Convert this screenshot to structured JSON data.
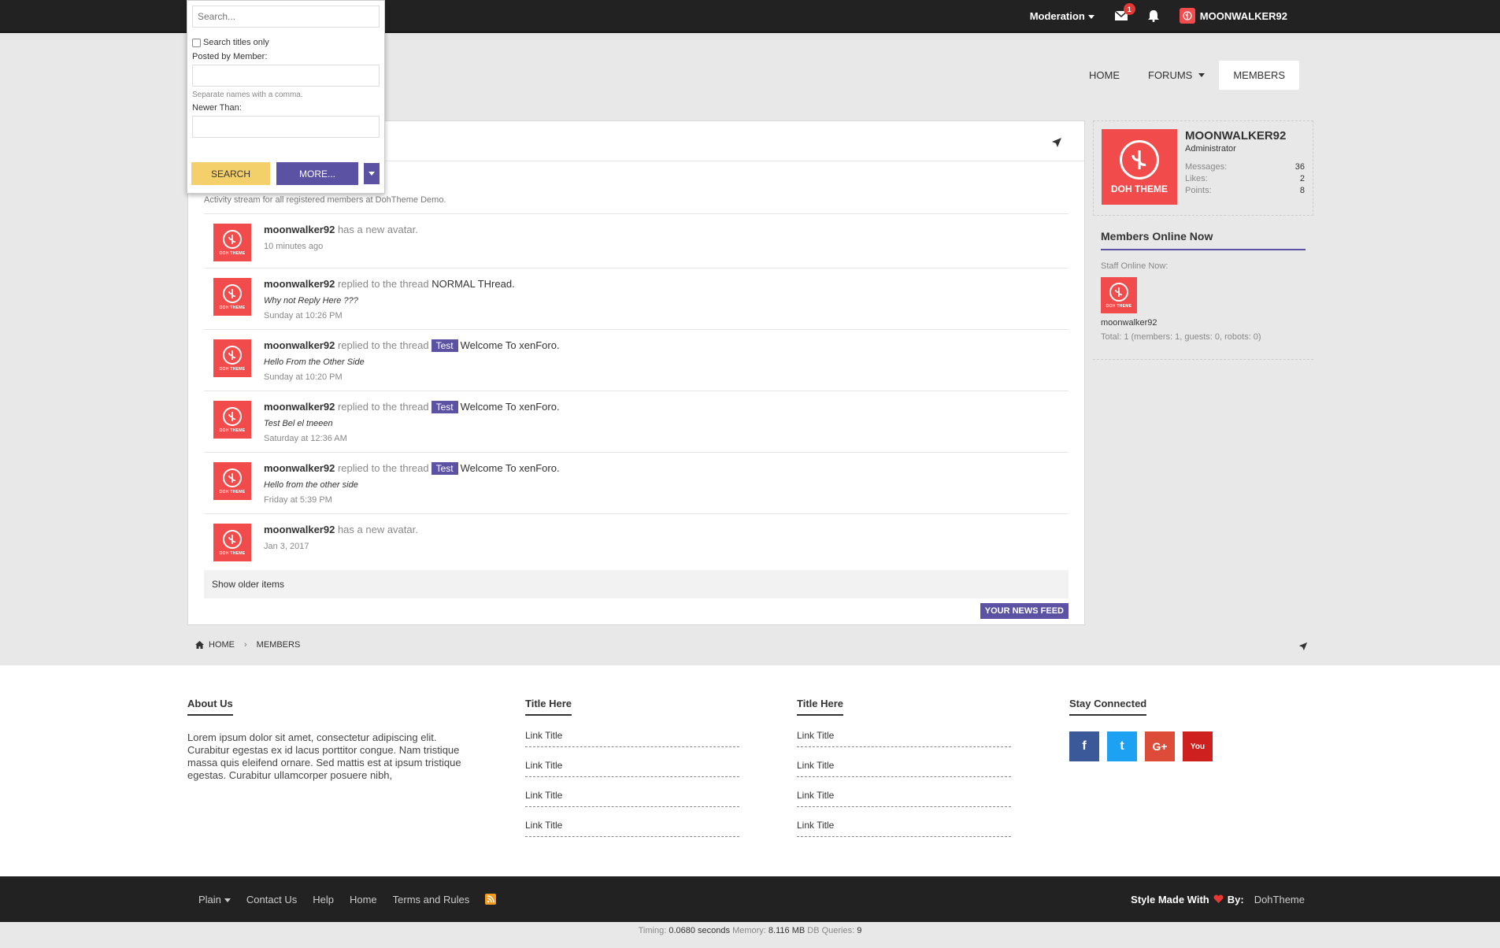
{
  "topbar": {
    "moderation": "Moderation",
    "inbox_count": "1",
    "username": "MOONWALKER92"
  },
  "nav": {
    "items": [
      "HOME",
      "FORUMS",
      "MEMBERS"
    ]
  },
  "search_popup": {
    "placeholder": "Search...",
    "titles_only": "Search titles only",
    "posted_by": "Posted by Member:",
    "separate_hint": "Separate names with a comma.",
    "newer_than": "Newer Than:",
    "search_btn": "Search",
    "more_btn": "More..."
  },
  "main": {
    "description": "Activity stream for all registered members at DohTheme Demo.",
    "feed": [
      {
        "user": "moonwalker92",
        "action": "has a new avatar.",
        "tag": "",
        "thread": "",
        "snippet": "",
        "time": "10 minutes ago"
      },
      {
        "user": "moonwalker92",
        "action": "replied to the thread",
        "tag": "",
        "thread": "NORMAL THread.",
        "snippet": "Why not Reply Here ???",
        "time": "Sunday at 10:26 PM"
      },
      {
        "user": "moonwalker92",
        "action": "replied to the thread",
        "tag": "Test",
        "thread": "Welcome To xenForo.",
        "snippet": "Hello From the Other Side",
        "time": "Sunday at 10:20 PM"
      },
      {
        "user": "moonwalker92",
        "action": "replied to the thread",
        "tag": "Test",
        "thread": "Welcome To xenForo.",
        "snippet": "Test Bel el tneeen",
        "time": "Saturday at 12:36 AM"
      },
      {
        "user": "moonwalker92",
        "action": "replied to the thread",
        "tag": "Test",
        "thread": "Welcome To xenForo.",
        "snippet": "Hello from the other side",
        "time": "Friday at 5:39 PM"
      },
      {
        "user": "moonwalker92",
        "action": "has a new avatar.",
        "tag": "",
        "thread": "",
        "snippet": "",
        "time": "Jan 3, 2017"
      }
    ],
    "show_older": "Show older items",
    "news_feed_btn": "YOUR NEWS FEED"
  },
  "avatar_label": "DOH THEME",
  "sidebar": {
    "profile": {
      "name": "MOONWALKER92",
      "role": "Administrator",
      "stats": [
        {
          "label": "Messages:",
          "value": "36"
        },
        {
          "label": "Likes:",
          "value": "2"
        },
        {
          "label": "Points:",
          "value": "8"
        }
      ]
    },
    "online": {
      "title": "Members Online Now",
      "staff_label": "Staff Online Now:",
      "member": "moonwalker92",
      "total": "Total: 1 (members: 1, guests: 0, robots: 0)"
    }
  },
  "breadcrumb": [
    "HOME",
    "MEMBERS"
  ],
  "footer": {
    "about_title": "About Us",
    "about_text": "Lorem ipsum dolor sit amet, consectetur adipiscing elit. Curabitur egestas ex id lacus porttitor congue. Nam tristique massa quis eleifend ornare. Sed mattis est at ipsum tristique egestas. Curabitur ullamcorper posuere nibh,",
    "col2_title": "Title Here",
    "col3_title": "Title Here",
    "link_title": "Link Title",
    "social_title": "Stay Connected",
    "social": [
      {
        "name": "facebook",
        "color": "#3b5998",
        "glyph": "f"
      },
      {
        "name": "twitter",
        "color": "#1da1f2",
        "glyph": "t"
      },
      {
        "name": "google-plus",
        "color": "#dd4b39",
        "glyph": "G+"
      },
      {
        "name": "youtube",
        "color": "#cd201f",
        "glyph": "You"
      }
    ]
  },
  "bottombar": {
    "links": [
      "Plain",
      "Contact Us",
      "Help",
      "Home",
      "Terms and Rules"
    ],
    "made_with": "Style Made With",
    "by": "By:",
    "brand": "DohTheme"
  },
  "timing": {
    "timing_label": "Timing:",
    "timing_value": "0.0680 seconds",
    "memory_label": "Memory:",
    "memory_value": "8.116 MB",
    "db_label": "DB Queries:",
    "db_value": "9"
  },
  "colors": {
    "accent": "#5b52a3",
    "avatar_red": "#f24b4b",
    "search_yellow": "#f4d06a",
    "dark": "#222222"
  }
}
